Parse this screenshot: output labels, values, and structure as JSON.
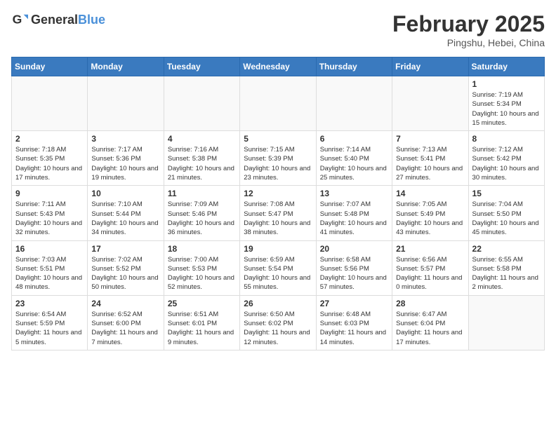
{
  "header": {
    "logo_general": "General",
    "logo_blue": "Blue",
    "title": "February 2025",
    "location": "Pingshu, Hebei, China"
  },
  "weekdays": [
    "Sunday",
    "Monday",
    "Tuesday",
    "Wednesday",
    "Thursday",
    "Friday",
    "Saturday"
  ],
  "weeks": [
    [
      {
        "day": "",
        "empty": true
      },
      {
        "day": "",
        "empty": true
      },
      {
        "day": "",
        "empty": true
      },
      {
        "day": "",
        "empty": true
      },
      {
        "day": "",
        "empty": true
      },
      {
        "day": "",
        "empty": true
      },
      {
        "day": "1",
        "sunrise": "7:19 AM",
        "sunset": "5:34 PM",
        "daylight": "Daylight: 10 hours and 15 minutes."
      }
    ],
    [
      {
        "day": "2",
        "sunrise": "7:18 AM",
        "sunset": "5:35 PM",
        "daylight": "Daylight: 10 hours and 17 minutes."
      },
      {
        "day": "3",
        "sunrise": "7:17 AM",
        "sunset": "5:36 PM",
        "daylight": "Daylight: 10 hours and 19 minutes."
      },
      {
        "day": "4",
        "sunrise": "7:16 AM",
        "sunset": "5:38 PM",
        "daylight": "Daylight: 10 hours and 21 minutes."
      },
      {
        "day": "5",
        "sunrise": "7:15 AM",
        "sunset": "5:39 PM",
        "daylight": "Daylight: 10 hours and 23 minutes."
      },
      {
        "day": "6",
        "sunrise": "7:14 AM",
        "sunset": "5:40 PM",
        "daylight": "Daylight: 10 hours and 25 minutes."
      },
      {
        "day": "7",
        "sunrise": "7:13 AM",
        "sunset": "5:41 PM",
        "daylight": "Daylight: 10 hours and 27 minutes."
      },
      {
        "day": "8",
        "sunrise": "7:12 AM",
        "sunset": "5:42 PM",
        "daylight": "Daylight: 10 hours and 30 minutes."
      }
    ],
    [
      {
        "day": "9",
        "sunrise": "7:11 AM",
        "sunset": "5:43 PM",
        "daylight": "Daylight: 10 hours and 32 minutes."
      },
      {
        "day": "10",
        "sunrise": "7:10 AM",
        "sunset": "5:44 PM",
        "daylight": "Daylight: 10 hours and 34 minutes."
      },
      {
        "day": "11",
        "sunrise": "7:09 AM",
        "sunset": "5:46 PM",
        "daylight": "Daylight: 10 hours and 36 minutes."
      },
      {
        "day": "12",
        "sunrise": "7:08 AM",
        "sunset": "5:47 PM",
        "daylight": "Daylight: 10 hours and 38 minutes."
      },
      {
        "day": "13",
        "sunrise": "7:07 AM",
        "sunset": "5:48 PM",
        "daylight": "Daylight: 10 hours and 41 minutes."
      },
      {
        "day": "14",
        "sunrise": "7:05 AM",
        "sunset": "5:49 PM",
        "daylight": "Daylight: 10 hours and 43 minutes."
      },
      {
        "day": "15",
        "sunrise": "7:04 AM",
        "sunset": "5:50 PM",
        "daylight": "Daylight: 10 hours and 45 minutes."
      }
    ],
    [
      {
        "day": "16",
        "sunrise": "7:03 AM",
        "sunset": "5:51 PM",
        "daylight": "Daylight: 10 hours and 48 minutes."
      },
      {
        "day": "17",
        "sunrise": "7:02 AM",
        "sunset": "5:52 PM",
        "daylight": "Daylight: 10 hours and 50 minutes."
      },
      {
        "day": "18",
        "sunrise": "7:00 AM",
        "sunset": "5:53 PM",
        "daylight": "Daylight: 10 hours and 52 minutes."
      },
      {
        "day": "19",
        "sunrise": "6:59 AM",
        "sunset": "5:54 PM",
        "daylight": "Daylight: 10 hours and 55 minutes."
      },
      {
        "day": "20",
        "sunrise": "6:58 AM",
        "sunset": "5:56 PM",
        "daylight": "Daylight: 10 hours and 57 minutes."
      },
      {
        "day": "21",
        "sunrise": "6:56 AM",
        "sunset": "5:57 PM",
        "daylight": "Daylight: 11 hours and 0 minutes."
      },
      {
        "day": "22",
        "sunrise": "6:55 AM",
        "sunset": "5:58 PM",
        "daylight": "Daylight: 11 hours and 2 minutes."
      }
    ],
    [
      {
        "day": "23",
        "sunrise": "6:54 AM",
        "sunset": "5:59 PM",
        "daylight": "Daylight: 11 hours and 5 minutes."
      },
      {
        "day": "24",
        "sunrise": "6:52 AM",
        "sunset": "6:00 PM",
        "daylight": "Daylight: 11 hours and 7 minutes."
      },
      {
        "day": "25",
        "sunrise": "6:51 AM",
        "sunset": "6:01 PM",
        "daylight": "Daylight: 11 hours and 9 minutes."
      },
      {
        "day": "26",
        "sunrise": "6:50 AM",
        "sunset": "6:02 PM",
        "daylight": "Daylight: 11 hours and 12 minutes."
      },
      {
        "day": "27",
        "sunrise": "6:48 AM",
        "sunset": "6:03 PM",
        "daylight": "Daylight: 11 hours and 14 minutes."
      },
      {
        "day": "28",
        "sunrise": "6:47 AM",
        "sunset": "6:04 PM",
        "daylight": "Daylight: 11 hours and 17 minutes."
      },
      {
        "day": "",
        "empty": true
      }
    ]
  ]
}
